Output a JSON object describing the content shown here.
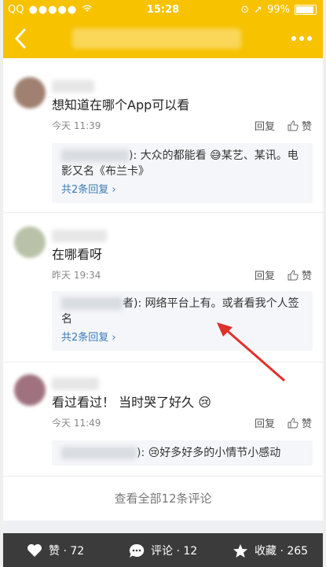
{
  "statusbar": {
    "carrier": "QQ",
    "time": "15:28",
    "battery": "99%",
    "signal_icon": "signal-dots-icon",
    "wifi_icon": "wifi-icon"
  },
  "navbar": {
    "back_icon": "chevron-left-icon",
    "title": "",
    "more_icon": "more-dots-icon"
  },
  "comments": [
    {
      "text": "想知道在哪个App可以看",
      "time": "今天 11:39",
      "reply_label": "回复",
      "like_label": "赞",
      "reply_preview": {
        "suffix": "): 大众的都能看",
        "suffix2": "某艺、某讯。电影又名《布兰卡》",
        "more": "共2条回复 ›"
      }
    },
    {
      "text": "在哪看呀",
      "time": "昨天 19:34",
      "reply_label": "回复",
      "like_label": "赞",
      "reply_preview": {
        "suffix": "者): 网络平台上有。或者看我个人签名",
        "more": "共2条回复 ›"
      }
    },
    {
      "text": "看过看过！ 当时哭了好久",
      "time": "今天 11:49",
      "reply_label": "回复",
      "like_label": "赞",
      "reply_preview": {
        "suffix": "): ",
        "suffix2": "好多好多的小情节小感动"
      }
    }
  ],
  "view_all": "查看全部12条评论",
  "bottombar": {
    "like": "赞 · 72",
    "comment": "评论 · 12",
    "favorite": "收藏 · 265"
  },
  "colors": {
    "brand": "#f7c200",
    "link": "#3d7ab8",
    "annotation_arrow": "#e0302a"
  }
}
